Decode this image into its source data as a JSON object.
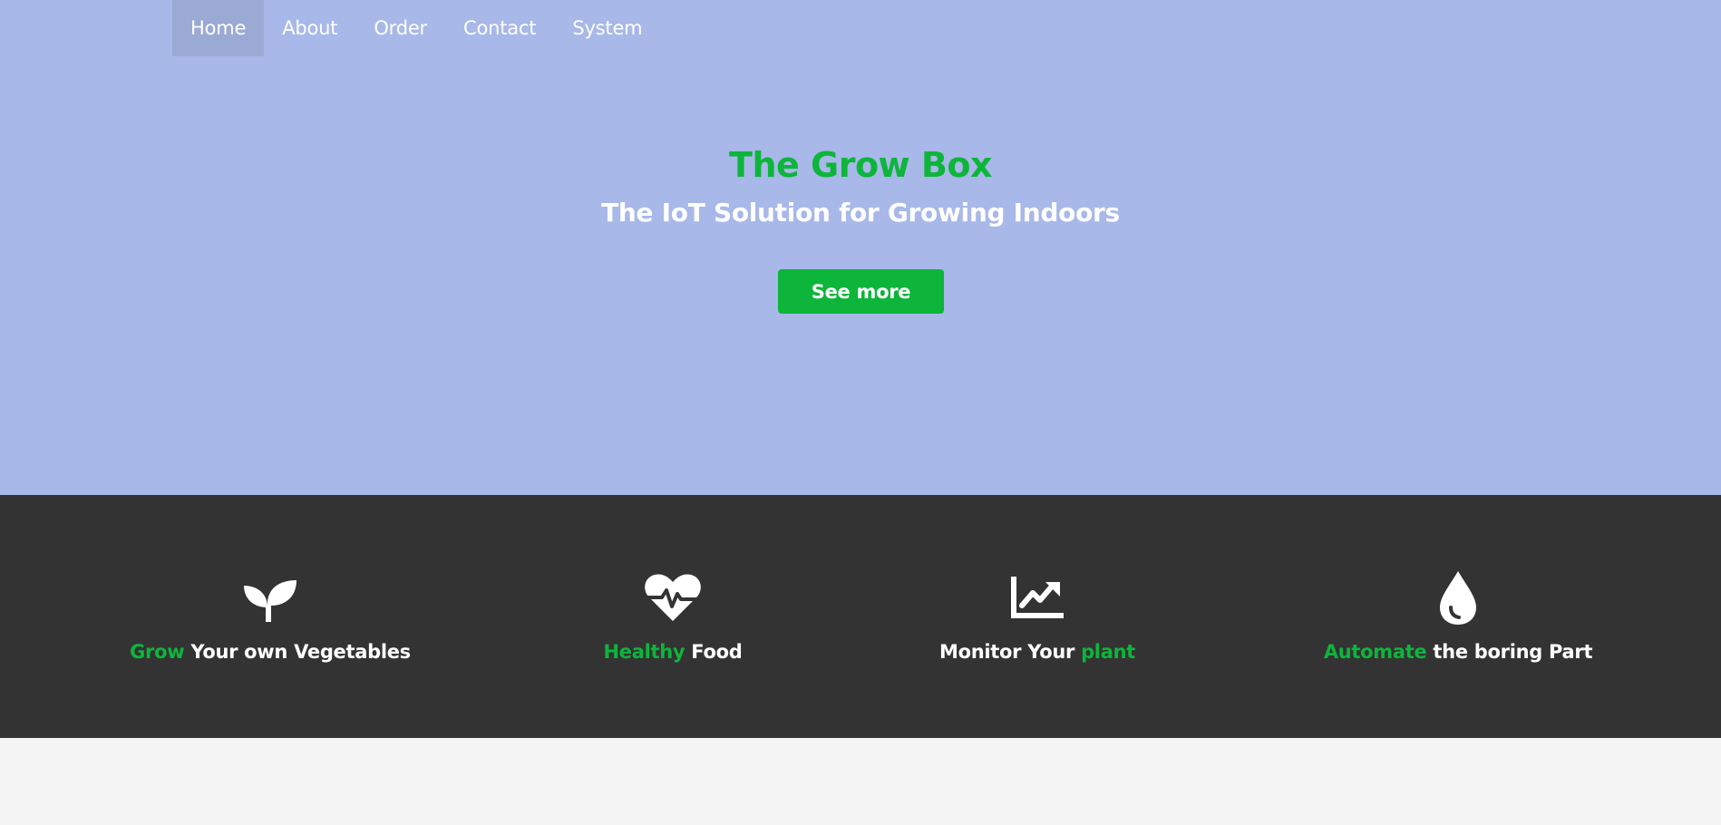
{
  "nav": {
    "items": [
      {
        "label": "Home",
        "active": true
      },
      {
        "label": "About"
      },
      {
        "label": "Order"
      },
      {
        "label": "Contact"
      },
      {
        "label": "System"
      }
    ]
  },
  "hero": {
    "title": "The Grow Box",
    "subtitle": "The IoT Solution for Growing Indoors",
    "cta_label": "See more"
  },
  "features": [
    {
      "icon": "seedling-icon",
      "highlight": "Grow",
      "rest": " Your own Vegetables"
    },
    {
      "icon": "heartbeat-icon",
      "highlight": "Healthy",
      "rest": " Food"
    },
    {
      "prefix": "Monitor Your ",
      "icon": "chart-line-icon",
      "highlight": "plant"
    },
    {
      "icon": "water-drop-icon",
      "highlight": "Automate",
      "rest": " the boring Part"
    }
  ],
  "colors": {
    "hero_bg": "#a8b8e8",
    "accent": "#0db53b",
    "features_bg": "#333333",
    "page_bg": "#f4f4f4"
  }
}
